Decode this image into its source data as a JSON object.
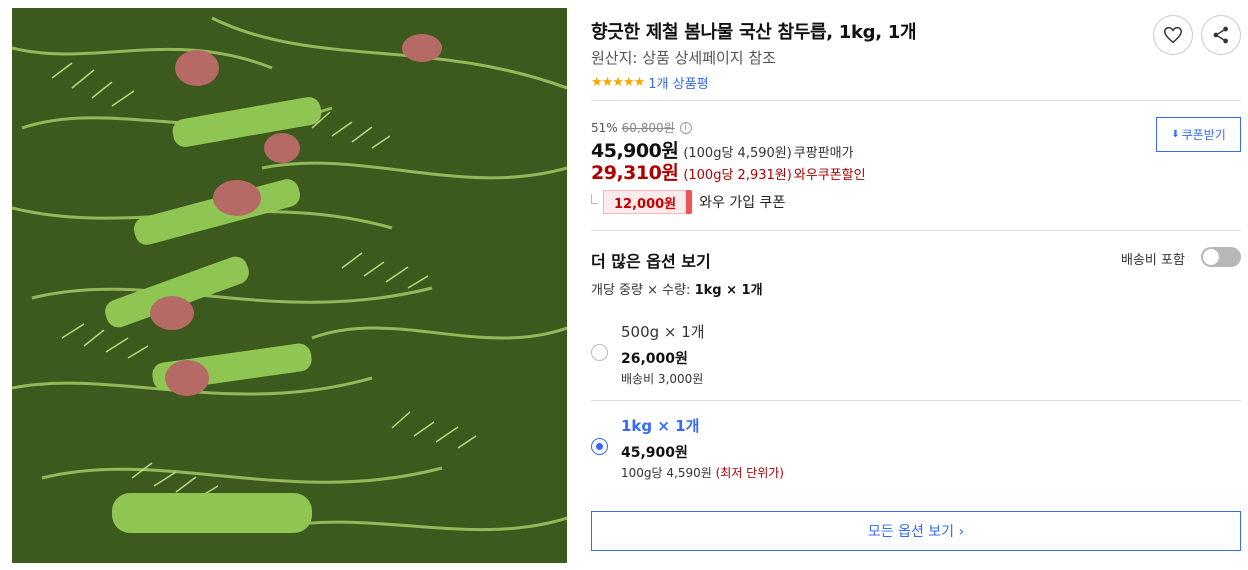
{
  "product": {
    "title": "향긋한 제철 봄나물 국산 참두릅, 1kg, 1개",
    "origin": "원산지: 상품 상세페이지 참조",
    "stars": "★★★★★",
    "review_link": "1개 상품평",
    "rating": 5,
    "image_icon": "fresh-aralia-shoots-photo"
  },
  "actions": {
    "favorite_icon": "heart-icon",
    "share_icon": "share-icon"
  },
  "pricing": {
    "discount_rate": "51%",
    "original_price": "60,800원",
    "info_icon": "i",
    "sale_price": "45,900원",
    "sale_unit": "(100g당 4,590원)",
    "sale_label": "쿠팡판매가",
    "wow_price": "29,310원",
    "wow_unit": "(100g당 2,931원)",
    "wow_label": "와우쿠폰할인",
    "coupon_amount": "12,000원",
    "coupon_text": "와우 가입 쿠폰",
    "coupon_button": "쿠폰받기"
  },
  "options": {
    "section_title": "더 많은 옵션 보기",
    "shipping_toggle_label": "배송비 포함",
    "shipping_toggle_on": false,
    "attr_prefix": "개당 중량 × 수량:",
    "attr_value": "1kg × 1개",
    "items": [
      {
        "name": "500g × 1개",
        "price": "26,000원",
        "sub": "배송비 3,000원",
        "sub_note": "",
        "selected": false
      },
      {
        "name": "1kg × 1개",
        "price": "45,900원",
        "sub": "100g당 4,590원",
        "sub_note": "(최저 단위가)",
        "selected": true
      }
    ],
    "all_options_button": "모든 옵션 보기 ›"
  },
  "colors": {
    "accent": "#346aff",
    "sale_red": "#ae0000",
    "star": "#f6a700"
  }
}
